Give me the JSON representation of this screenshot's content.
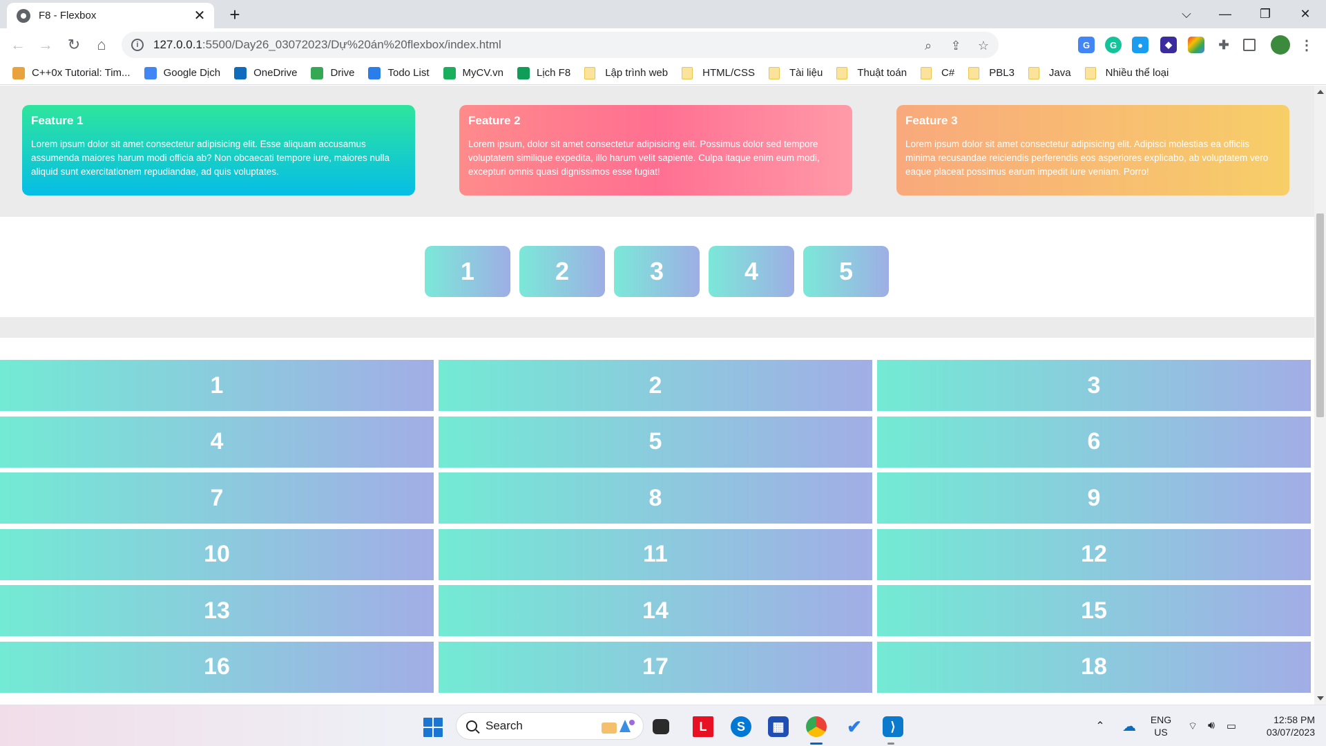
{
  "browser": {
    "tab_title": "F8 - Flexbox",
    "new_tab_label": "+",
    "url_host": "127.0.0.1",
    "url_path": ":5500/Day26_03072023/Dự%20án%20flexbox/index.html",
    "bookmarks": [
      {
        "label": "C++0x Tutorial: Tim...",
        "kind": "site",
        "color": "#e8a33c"
      },
      {
        "label": "Google Dịch",
        "kind": "site",
        "color": "#4285f4"
      },
      {
        "label": "OneDrive",
        "kind": "site",
        "color": "#0f6cbd"
      },
      {
        "label": "Drive",
        "kind": "site",
        "color": "#34a853"
      },
      {
        "label": "Todo List",
        "kind": "site",
        "color": "#2b7de9"
      },
      {
        "label": "MyCV.vn",
        "kind": "site",
        "color": "#1aaf5d"
      },
      {
        "label": "Lịch F8",
        "kind": "site",
        "color": "#0f9d58"
      },
      {
        "label": "Lập trình web",
        "kind": "folder"
      },
      {
        "label": "HTML/CSS",
        "kind": "folder"
      },
      {
        "label": "Tài liệu",
        "kind": "folder"
      },
      {
        "label": "Thuật toán",
        "kind": "folder"
      },
      {
        "label": "C#",
        "kind": "folder"
      },
      {
        "label": "PBL3",
        "kind": "folder"
      },
      {
        "label": "Java",
        "kind": "folder"
      },
      {
        "label": "Nhiều thể loại",
        "kind": "folder"
      }
    ]
  },
  "features": [
    {
      "title": "Feature 1",
      "text": "Lorem ipsum dolor sit amet consectetur adipisicing elit. Esse aliquam accusamus assumenda maiores harum modi officia ab? Non obcaecati tempore iure, maiores nulla aliquid sunt exercitationem repudiandae, ad quis voluptates."
    },
    {
      "title": "Feature 2",
      "text": "Lorem ipsum, dolor sit amet consectetur adipisicing elit. Possimus dolor sed tempore voluptatem similique expedita, illo harum velit sapiente. Culpa itaque enim eum modi, excepturi omnis quasi dignissimos esse fugiat!"
    },
    {
      "title": "Feature 3",
      "text": "Lorem ipsum dolor sit amet consectetur adipisicing elit. Adipisci molestias ea officiis minima recusandae reiciendis perferendis eos asperiores explicabo, ab voluptatem vero eaque placeat possimus earum impedit iure veniam. Porro!"
    }
  ],
  "pills": [
    "1",
    "2",
    "3",
    "4",
    "5"
  ],
  "grid": [
    "1",
    "2",
    "3",
    "4",
    "5",
    "6",
    "7",
    "8",
    "9",
    "10",
    "11",
    "12",
    "13",
    "14",
    "15",
    "16",
    "17",
    "18"
  ],
  "taskbar": {
    "search_label": "Search",
    "lang_top": "ENG",
    "lang_bottom": "US",
    "time": "12:58 PM",
    "date": "03/07/2023"
  }
}
